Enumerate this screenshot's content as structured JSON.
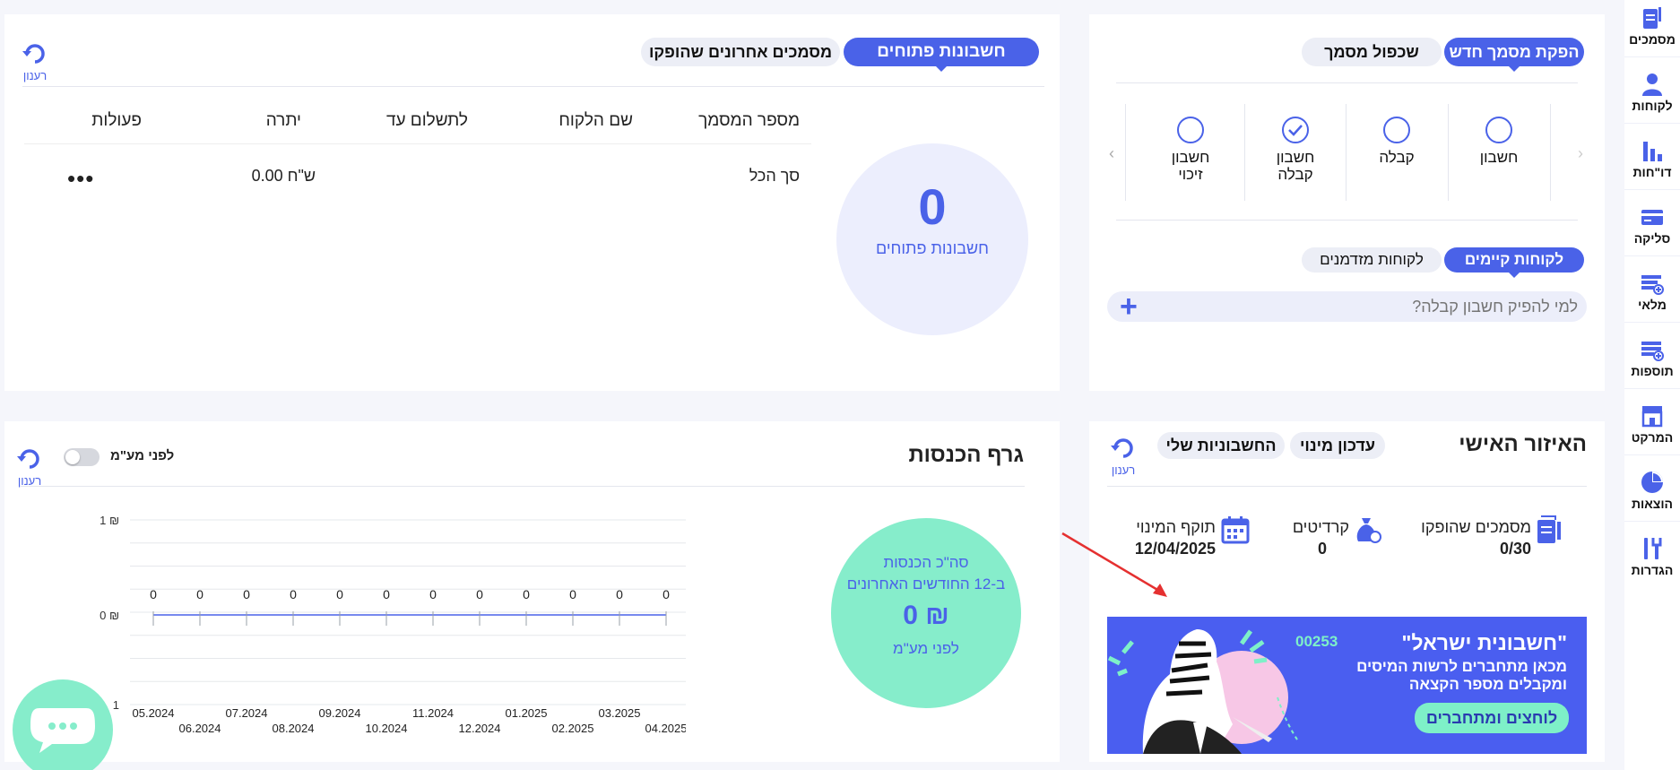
{
  "sidebar": {
    "items": [
      {
        "label": "מסמכים",
        "icon": "document-icon"
      },
      {
        "label": "לקוחות",
        "icon": "user-icon"
      },
      {
        "label": "דו\"חות",
        "icon": "bar-chart-icon"
      },
      {
        "label": "סליקה",
        "icon": "credit-card-icon"
      },
      {
        "label": "מלאי",
        "icon": "inventory-icon"
      },
      {
        "label": "תוספות",
        "icon": "add-ons-icon"
      },
      {
        "label": "המרקט",
        "icon": "store-icon"
      },
      {
        "label": "הוצאות",
        "icon": "pie-chart-icon"
      },
      {
        "label": "הגדרות",
        "icon": "tools-icon"
      }
    ]
  },
  "new_doc": {
    "tab_active": "הפקת מסמך חדש",
    "tab_inactive": "שכפול מסמך",
    "doc_types": [
      "חשבון",
      "קבלה",
      "חשבון קבלה",
      "חשבון זיכוי"
    ],
    "selected_doc_type": "חשבון קבלה",
    "customer_tab_active": "לקוחות קיימים",
    "customer_tab_inactive": "לקוחות מזדמנים",
    "search_placeholder": "למי להפיק חשבון קבלה?"
  },
  "open_accounts": {
    "tab_active": "חשבונות פתוחים",
    "tab_inactive": "מסמכים אחרונים שהופקו",
    "refresh_label": "רענון",
    "count": "0",
    "count_label": "חשבונות פתוחים",
    "columns": [
      "מספר המסמך",
      "שם הלקוח",
      "לתשלום עד",
      "יתרה",
      "פעולות"
    ],
    "total_row": {
      "label": "סך הכל",
      "balance": "0.00 ש\"ח"
    }
  },
  "personal_area": {
    "title": "האיזור האישי",
    "btn_subscription": "עדכון מינוי",
    "btn_invoices": "החשבוניות שלי",
    "refresh_label": "רענון",
    "stats": [
      {
        "label": "מסמכים שהופקו",
        "value": "0/30",
        "icon": "documents-icon"
      },
      {
        "label": "קרדיטים",
        "value": "0",
        "icon": "money-bag-icon"
      },
      {
        "label": "תוקף המינוי",
        "value": "12/04/2025",
        "icon": "calendar-icon"
      }
    ],
    "banner": {
      "title": "\"חשבונית ישראל\"",
      "line1": "מכאן מתחברים לרשות המיסים",
      "line2": "ומקבלים מספר הקצאה",
      "code": "00253",
      "cta": "לוחצים ומתחברים",
      "bg_color": "#4a5ef0",
      "cta_color": "#7ef0c8"
    }
  },
  "income_chart": {
    "title": "גרף הכנסות",
    "toggle_label": "לפני מע\"מ",
    "refresh_label": "רענון",
    "summary": {
      "line1": "סה\"כ הכנסות",
      "line2": "ב-12 החודשים האחרונים",
      "amount": "0 ₪",
      "note": "לפני מע\"מ"
    }
  },
  "chart_data": {
    "type": "line",
    "x": [
      "05.2024",
      "06.2024",
      "07.2024",
      "08.2024",
      "09.2024",
      "10.2024",
      "11.2024",
      "12.2024",
      "01.2025",
      "02.2025",
      "03.2025",
      "04.2025"
    ],
    "values": [
      0,
      0,
      0,
      0,
      0,
      0,
      0,
      0,
      0,
      0,
      0,
      0
    ],
    "y_tick_labels": [
      "1 ₪",
      "0 ₪",
      "1"
    ],
    "grid": true
  },
  "colors": {
    "accent": "#4a62e8",
    "mint": "#86edcb",
    "lavender": "#eceefd"
  }
}
